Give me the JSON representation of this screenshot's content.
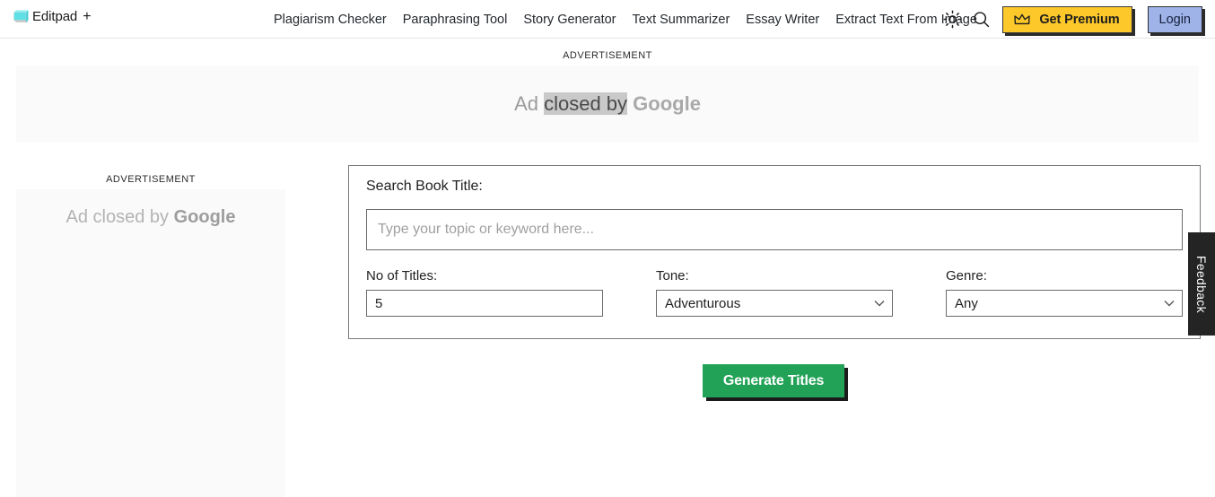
{
  "header": {
    "brand": {
      "name": "Editpad",
      "plus": "+",
      "icon": "notepad-icon"
    },
    "nav": [
      {
        "label": "Plagiarism Checker"
      },
      {
        "label": "Paraphrasing Tool"
      },
      {
        "label": "Story Generator"
      },
      {
        "label": "Text Summarizer"
      },
      {
        "label": "Essay Writer"
      },
      {
        "label": "Extract Text From Image"
      }
    ],
    "theme_toggle_icon": "sun-icon",
    "search_icon": "search-icon",
    "premium": {
      "label": "Get Premium",
      "icon": "crown-icon",
      "color": "#fcc82a"
    },
    "login": {
      "label": "Login",
      "color": "#9fb3e8"
    }
  },
  "ads": {
    "top": {
      "label": "ADVERTISEMENT",
      "text_prefix": "Ad ",
      "text_highlight": "closed by",
      "text_suffix": " Google"
    },
    "left": {
      "label": "ADVERTISEMENT",
      "text_prefix": "Ad closed by ",
      "text_brand": "Google"
    }
  },
  "form": {
    "title": "Search Book Title:",
    "search": {
      "placeholder": "Type your topic or keyword here...",
      "value": ""
    },
    "num_titles": {
      "label": "No of Titles:",
      "value": "5"
    },
    "tone": {
      "label": "Tone:",
      "selected": "Adventurous",
      "options": [
        "Adventurous"
      ]
    },
    "genre": {
      "label": "Genre:",
      "selected": "Any",
      "options": [
        "Any"
      ]
    },
    "submit": {
      "label": "Generate Titles",
      "color": "#22a257"
    }
  },
  "feedback": {
    "label": "Feedback"
  }
}
